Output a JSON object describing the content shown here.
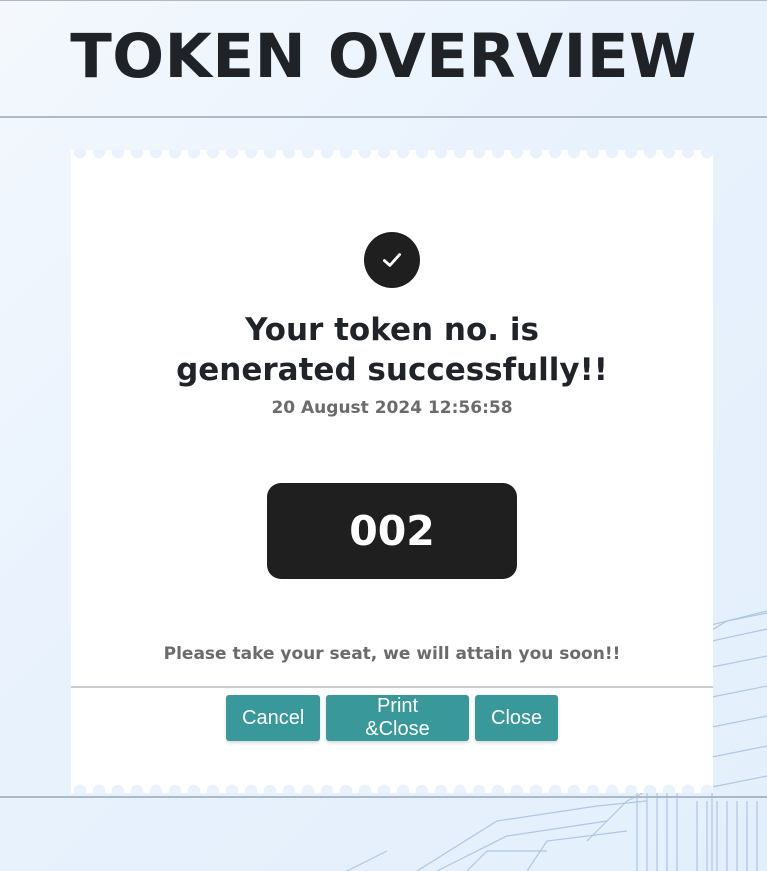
{
  "header": {
    "title": "TOKEN OVERVIEW"
  },
  "ticket": {
    "success_message": "Your token no. is generated successfully!!",
    "timestamp": "20 August 2024 12:56:58",
    "token_number": "002",
    "instruction": "Please take your seat, we will attain you soon!!",
    "icons": {
      "status": "check-circle-icon"
    }
  },
  "actions": {
    "cancel_label": "Cancel",
    "print_close_label": "Print &Close",
    "close_label": "Close"
  },
  "colors": {
    "accent": "#38989a",
    "token_bg": "#1f1f1f",
    "title_text": "#202328"
  }
}
